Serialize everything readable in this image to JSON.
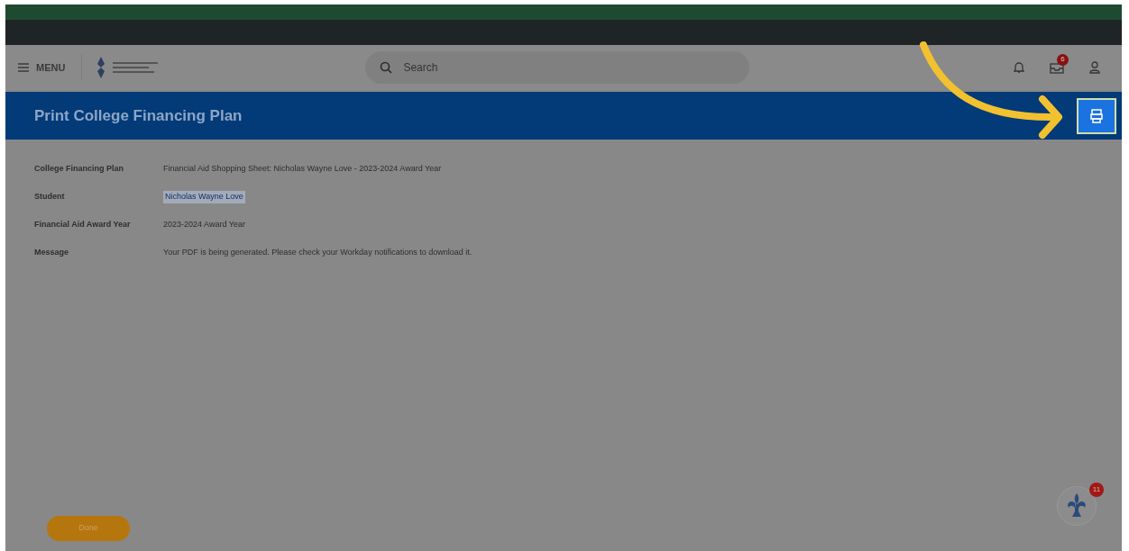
{
  "header": {
    "menu_label": "MENU",
    "search": {
      "placeholder": "Search"
    },
    "inbox_badge": "6"
  },
  "page": {
    "title": "Print College Financing Plan"
  },
  "fields": [
    {
      "kind": "text",
      "label": "College Financing Plan",
      "value": "Financial Aid Shopping Sheet: Nicholas Wayne Love - 2023-2024 Award Year"
    },
    {
      "kind": "link",
      "label": "Student",
      "value": "Nicholas Wayne Love"
    },
    {
      "kind": "text",
      "label": "Financial Aid Award Year",
      "value": "2023-2024 Award Year"
    },
    {
      "kind": "text",
      "label": "Message",
      "value": "Your PDF is being generated. Please check your Workday notifications to download it."
    }
  ],
  "done_button": "Done",
  "assistant_badge": "11"
}
